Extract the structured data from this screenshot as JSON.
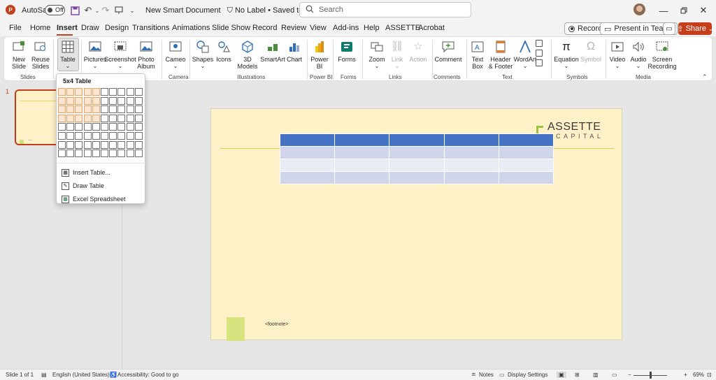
{
  "titlebar": {
    "app_logo": "P",
    "autosave_label": "AutoSave",
    "autosave_state": "Off",
    "document_title": "New Smart Document",
    "label_status": "No Label",
    "save_status": "Saved to this PC",
    "search_placeholder": "Search",
    "icons": [
      "save-icon",
      "undo-icon",
      "redo-icon",
      "touch-mode-icon",
      "customize-icon"
    ]
  },
  "menu": {
    "tabs": [
      "File",
      "Home",
      "Insert",
      "Draw",
      "Design",
      "Transitions",
      "Animations",
      "Slide Show",
      "Record",
      "Review",
      "View",
      "Add-ins",
      "Help",
      "ASSETTE",
      "Acrobat"
    ],
    "active_tab": "Insert",
    "record_label": "Record",
    "present_label": "Present in Teams",
    "share_label": "Share"
  },
  "ribbon": {
    "buttons": {
      "new_slide": "New\nSlide",
      "reuse_slides": "Reuse\nSlides",
      "table": "Table",
      "pictures": "Pictures",
      "screenshot": "Screenshot",
      "photo_album": "Photo\nAlbum",
      "cameo": "Cameo",
      "shapes": "Shapes",
      "icons": "Icons",
      "models_3d": "3D\nModels",
      "smartart": "SmartArt",
      "chart": "Chart",
      "power_bi": "Power\nBI",
      "forms": "Forms",
      "zoom": "Zoom",
      "link": "Link",
      "action": "Action",
      "comment": "Comment",
      "text_box": "Text\nBox",
      "header_footer": "Header\n& Footer",
      "wordart": "WordArt",
      "equation": "Equation",
      "symbol": "Symbol",
      "video": "Video",
      "audio": "Audio",
      "screen_recording": "Screen\nRecording"
    },
    "groups": {
      "slides": "Slides",
      "camera": "Camera",
      "illustrations": "Illustrations",
      "power_bi": "Power BI",
      "forms": "Forms",
      "links": "Links",
      "comments": "Comments",
      "text": "Text",
      "symbols": "Symbols",
      "media": "Media"
    }
  },
  "table_dropdown": {
    "title": "5x4 Table",
    "grid_cols": 10,
    "grid_rows": 8,
    "highlight_cols": 5,
    "highlight_rows": 4,
    "items": [
      "Insert Table...",
      "Draw Table",
      "Excel Spreadsheet"
    ]
  },
  "thumbnails": {
    "slide_number": "1",
    "footer_mark": "—"
  },
  "slide": {
    "logo_main": "ASSETTE",
    "logo_sub": "CAPITAL",
    "footnote": "<footnote>",
    "table": {
      "rows": 4,
      "cols": 5
    },
    "colors": {
      "background": "#fef1c8",
      "table_header": "#4472c4",
      "table_band": "#cfd5ea",
      "table_band_light": "#e9ebf5",
      "accent_green": "#9bc23b"
    }
  },
  "statusbar": {
    "slide_info": "Slide 1 of 1",
    "language": "English (United States)",
    "accessibility": "Accessibility: Good to go",
    "notes": "Notes",
    "display_settings": "Display Settings",
    "zoom_minus": "−",
    "zoom_plus": "+",
    "zoom_level": "69%"
  },
  "colors": {
    "accent": "#c43e1c"
  }
}
